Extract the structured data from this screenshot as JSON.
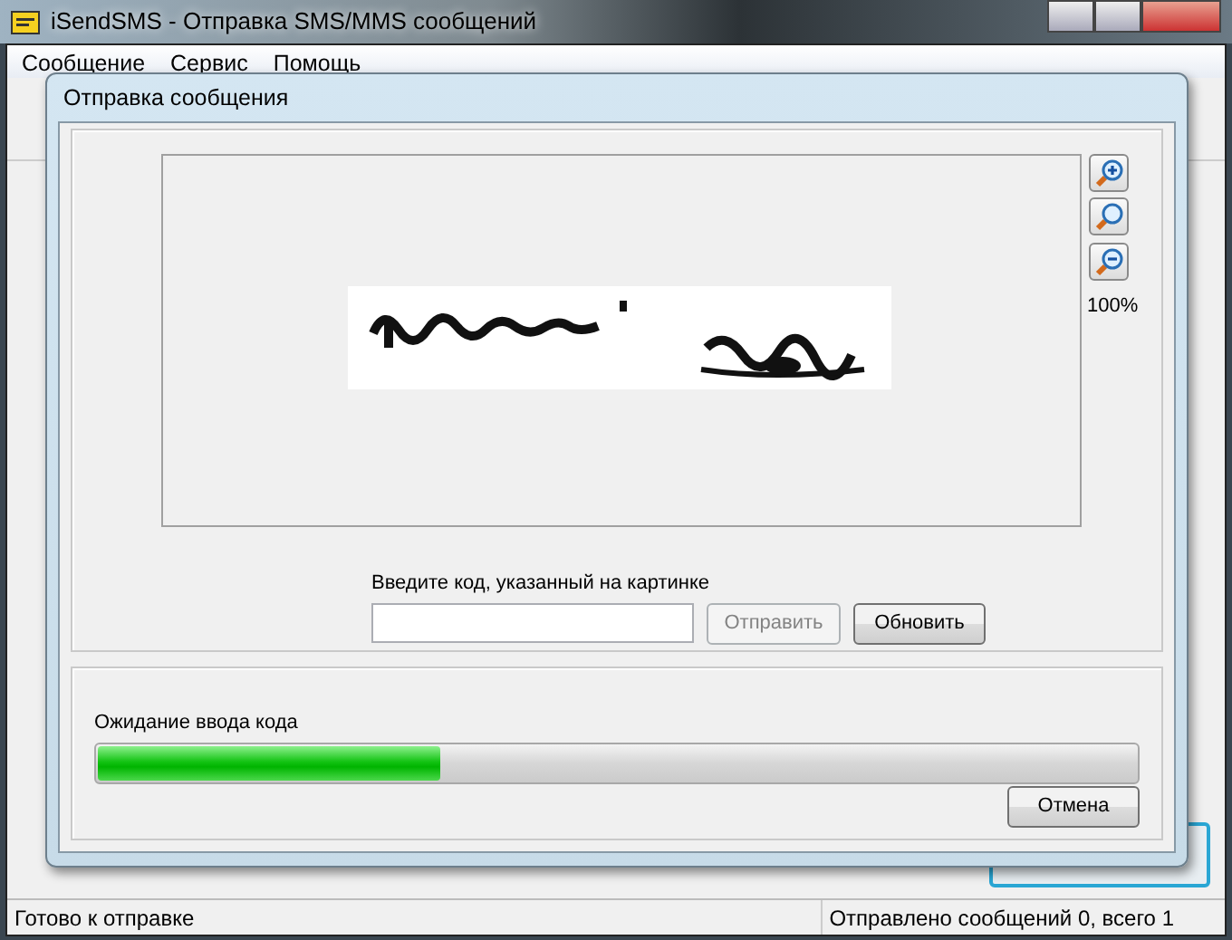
{
  "window": {
    "title": "iSendSMS - Отправка SMS/MMS сообщений"
  },
  "menu": [
    "Сообщение",
    "Сервис",
    "Помощь"
  ],
  "dialog": {
    "title": "Отправка сообщения",
    "captcha": {
      "zoom_label": "100%"
    },
    "code_prompt": "Введите код, указанный на картинке",
    "buttons": [
      {
        "label": "Отправить",
        "disabled": true
      },
      {
        "label": "Обновить",
        "disabled": false
      }
    ],
    "progress": {
      "label": "Ожидание ввода кода",
      "level": 0.33
    },
    "cancel": {
      "label": "Отмена",
      "disabled": false
    }
  },
  "status_bar": [
    "Готово к отправке",
    "Отправлено сообщений 0, всего 1"
  ]
}
